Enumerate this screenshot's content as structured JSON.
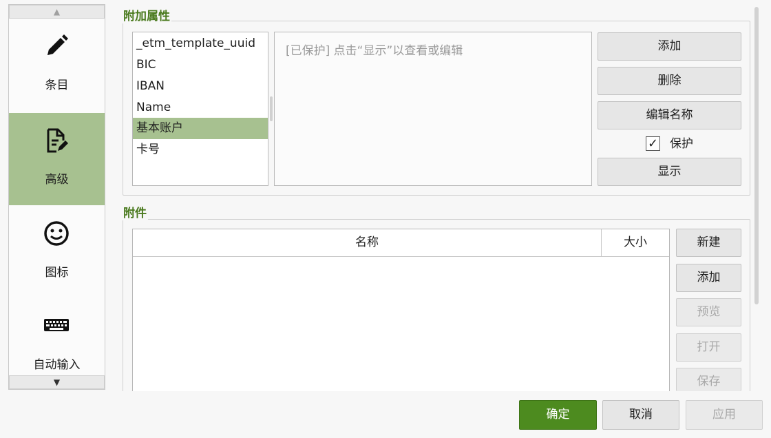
{
  "nav": {
    "items": [
      {
        "label": "条目",
        "icon": "pencil-icon"
      },
      {
        "label": "高级",
        "icon": "document-edit-icon",
        "active": true
      },
      {
        "label": "图标",
        "icon": "smiley-icon"
      },
      {
        "label": "自动输入",
        "icon": "keyboard-icon"
      }
    ],
    "up_arrow": "▲",
    "down_arrow": "▼"
  },
  "attributes": {
    "title": "附加属性",
    "items": [
      "_etm_template_uuid",
      "BIC",
      "IBAN",
      "Name",
      "基本账户",
      "卡号"
    ],
    "selected_index": 4,
    "value_placeholder": "[已保护] 点击“显示”以查看或编辑",
    "buttons": {
      "add": "添加",
      "delete": "删除",
      "rename": "编辑名称",
      "show": "显示"
    },
    "protect": {
      "label": "保护",
      "checked": true,
      "mark": "✓"
    }
  },
  "attachments": {
    "title": "附件",
    "columns": [
      "名称",
      "大小"
    ],
    "buttons": {
      "new": "新建",
      "add": "添加",
      "preview": "预览",
      "open": "打开",
      "save": "保存"
    }
  },
  "footer": {
    "ok": "确定",
    "cancel": "取消",
    "apply": "应用"
  },
  "colors": {
    "accent": "#4d8b1f",
    "selection": "#a7c190",
    "group_title": "#4a7a1e"
  }
}
